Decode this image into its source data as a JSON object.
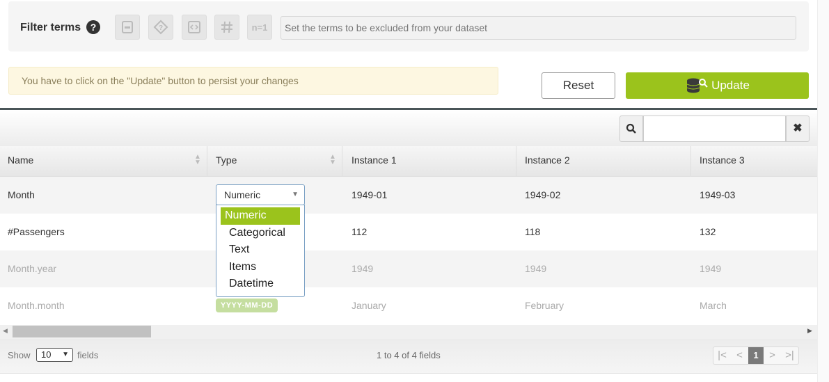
{
  "filter": {
    "label": "Filter terms",
    "help": "?",
    "placeholder": "Set the terms to be excluded from your dataset",
    "tool_count_label": "n=1"
  },
  "notice": "You have to click on the \"Update\" button to persist your changes",
  "buttons": {
    "reset": "Reset",
    "update": "Update"
  },
  "search": {
    "clear": "✖"
  },
  "table": {
    "columns": [
      "Name",
      "Type",
      "Instance 1",
      "Instance 2",
      "Instance 3"
    ],
    "rows": [
      {
        "name": "Month",
        "type": "Numeric",
        "values": [
          "1949-01",
          "1949-02",
          "1949-03"
        ]
      },
      {
        "name": "#Passengers",
        "type": "",
        "values": [
          "112",
          "118",
          "132"
        ]
      },
      {
        "name": "Month.year",
        "type": "",
        "values": [
          "1949",
          "1949",
          "1949"
        ]
      },
      {
        "name": "Month.month",
        "type": "YYYY-MM-DD",
        "values": [
          "January",
          "February",
          "March"
        ]
      }
    ]
  },
  "type_dropdown": {
    "selected": "Numeric",
    "options": [
      "Numeric",
      "Categorical",
      "Text",
      "Items",
      "Datetime"
    ]
  },
  "footer": {
    "show": "Show",
    "page_size": "10",
    "fields": "fields",
    "count": "1 to 4 of 4 fields",
    "current_page": "1",
    "first": "|<",
    "prev": "<",
    "next": ">",
    "last": ">|"
  },
  "colors": {
    "accent": "#9bc31c",
    "notice_bg": "#fdf7e1"
  }
}
